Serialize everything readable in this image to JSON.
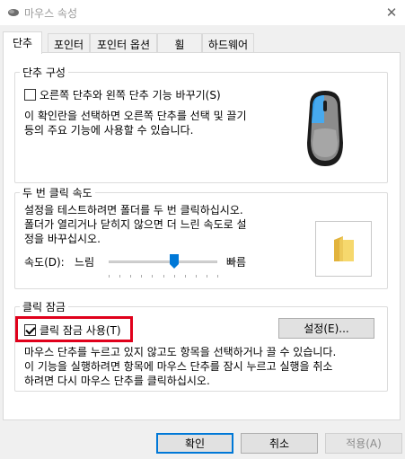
{
  "window": {
    "title": "마우스 속성",
    "close_glyph": "✕"
  },
  "tabs": [
    {
      "label": "단추",
      "active": true
    },
    {
      "label": "포인터",
      "active": false
    },
    {
      "label": "포인터 옵션",
      "active": false
    },
    {
      "label": "휠",
      "active": false
    },
    {
      "label": "하드웨어",
      "active": false
    }
  ],
  "button_config": {
    "group_label": "단추 구성",
    "swap_checkbox_label": "오른쪽 단추와 왼쪽 단추 기능 바꾸기(S)",
    "swap_checked": false,
    "description_line1": "이 확인란을 선택하면 오른쪽 단추를 선택 및 끌기",
    "description_line2": "등의 주요 기능에 사용할 수 있습니다."
  },
  "double_click": {
    "group_label": "두 번 클릭 속도",
    "description_line1": "설정을 테스트하려면 폴더를 두 번 클릭하십시오.",
    "description_line2": "폴더가 열리거나 닫히지 않으면 더 느린 속도로 설",
    "description_line3": "정을 바꾸십시오.",
    "speed_label": "속도(D):",
    "slow_label": "느림",
    "fast_label": "빠름",
    "speed_fraction": 0.6,
    "folder_icon": "folder-icon"
  },
  "click_lock": {
    "group_label": "클릭 잠금",
    "checkbox_label": "클릭 잠금 사용(T)",
    "checked": true,
    "settings_button": "설정(E)...",
    "description_line1": "마우스 단추를 누르고 있지 않고도 항목을 선택하거나 끌 수 있습니다.",
    "description_line2": "이 기능을 실행하려면 항목에 마우스 단추를 잠시 누르고 실행을 취소",
    "description_line3": "하려면 다시 마우스 단추를 클릭하십시오."
  },
  "footer": {
    "ok": "확인",
    "cancel": "취소",
    "apply": "적용(A)"
  },
  "colors": {
    "highlight": "#e0001b",
    "accent": "#0078d7"
  }
}
